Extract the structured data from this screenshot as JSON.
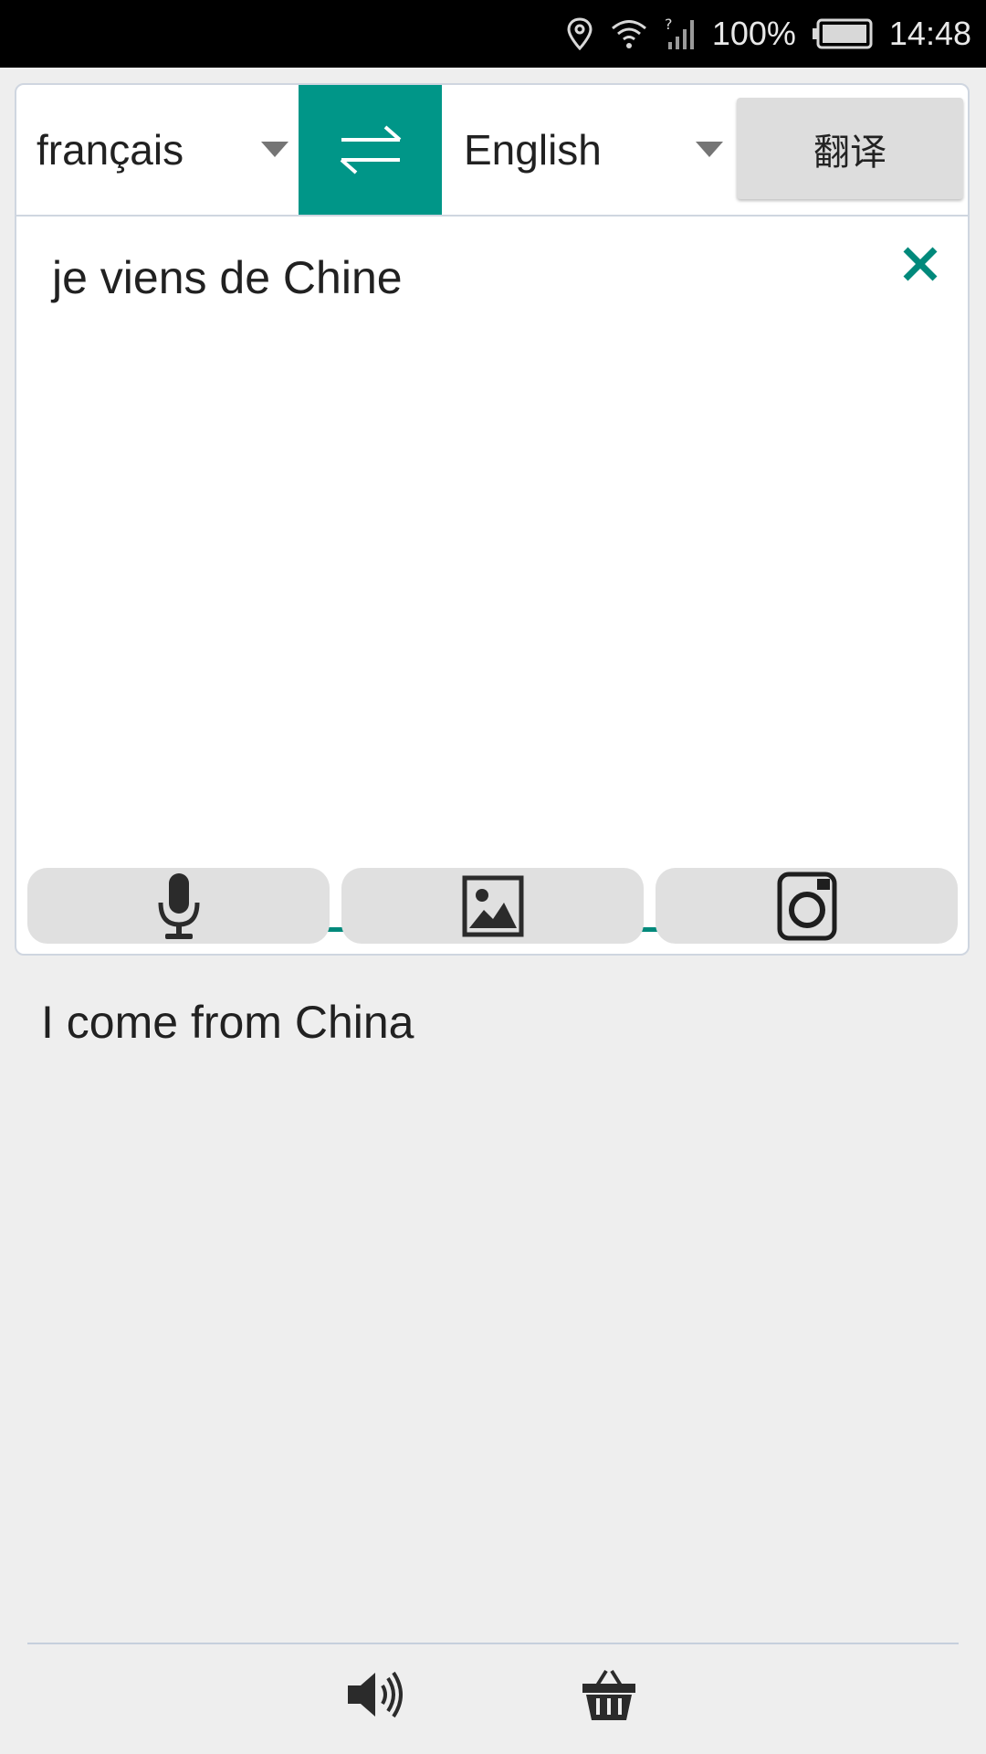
{
  "status_bar": {
    "battery": "100%",
    "time": "14:48",
    "icons": [
      "location-icon",
      "wifi-icon",
      "cell-signal-icon",
      "battery-icon"
    ]
  },
  "translator": {
    "source_language": "français",
    "target_language": "English",
    "translate_label": "翻译",
    "input_text": "je viens de Chine",
    "output_text": "I come from China",
    "accent_color": "#009688"
  },
  "tools": [
    "microphone-icon",
    "image-icon",
    "camera-icon"
  ],
  "bottom_actions": [
    "speaker-icon",
    "basket-icon"
  ]
}
